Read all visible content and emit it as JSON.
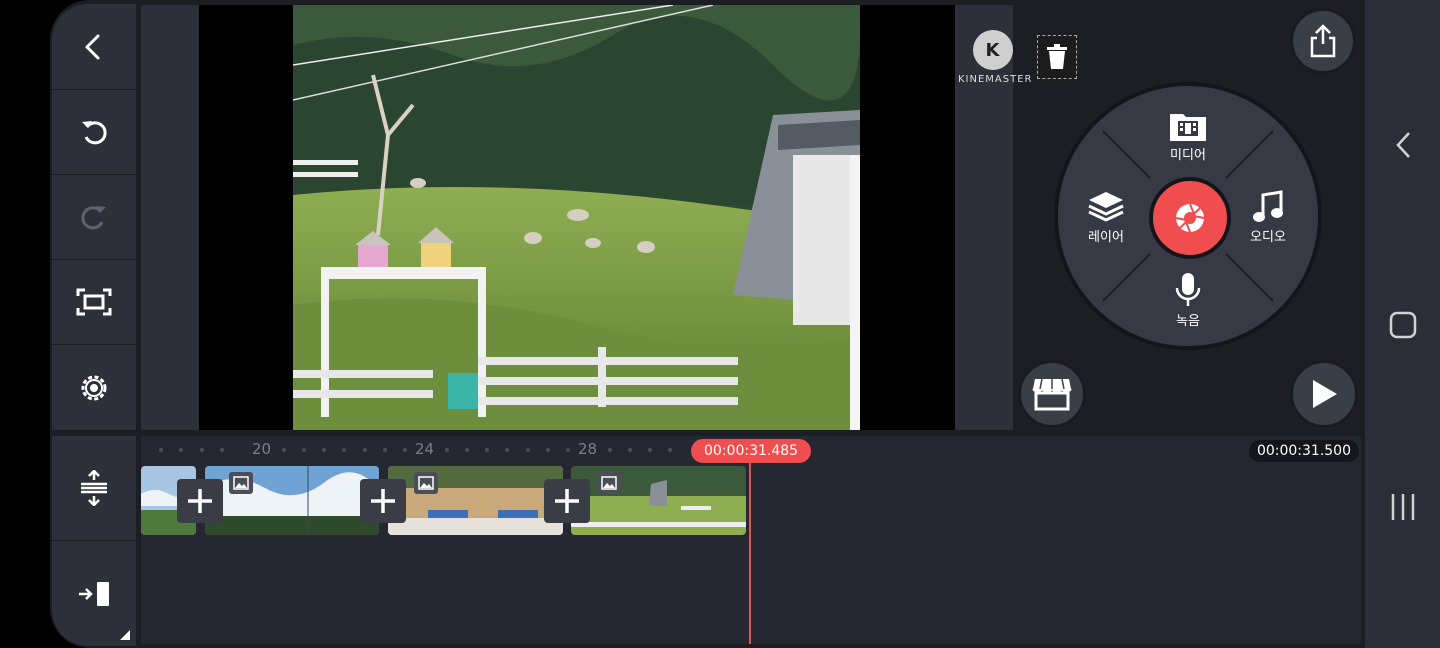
{
  "editor": {
    "logo_text": "KINEMASTER",
    "logo_letter": "K"
  },
  "wheel": {
    "media_label": "미디어",
    "layer_label": "레이어",
    "audio_label": "오디오",
    "record_label": "녹음"
  },
  "timeline": {
    "ruler_labels": [
      "20",
      "24",
      "28"
    ],
    "current_time": "00:00:31.485",
    "total_time": "00:00:31.500"
  },
  "colors": {
    "accent": "#f04e4e",
    "panel": "#2d3039",
    "background": "#1d1e24"
  },
  "icons": {
    "back": "back-arrow-icon",
    "undo": "undo-icon",
    "redo": "redo-icon",
    "fullscreen": "fullscreen-icon",
    "settings": "settings-gear-icon",
    "expand": "expand-tracks-icon",
    "jump": "jump-to-start-icon",
    "delete": "trash-icon",
    "share": "share-icon",
    "store": "store-icon",
    "play": "play-icon",
    "capture": "camera-aperture-icon"
  }
}
